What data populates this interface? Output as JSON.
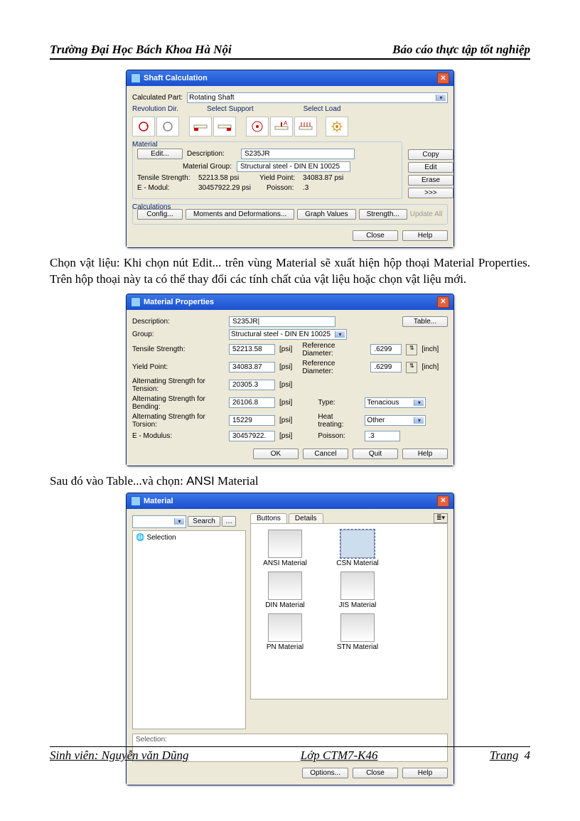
{
  "header": {
    "left": "Trường Đại Học Bách Khoa Hà Nội",
    "right": "Báo cáo thực tập tốt nghiệp"
  },
  "para1": "Chọn vật liệu: Khi chọn nút Edit... trên vùng Material sẽ xuất hiện hộp thoại Material Properties. Trên hộp thoại này ta có thể thay đổi các tính chất của vật liệu hoặc chọn vật liệu mới.",
  "para2_pre": "Sau đó vào Table...và chọn: ",
  "para2_ansi": "ANSI",
  "para2_post": " Material",
  "dlg1": {
    "title": "Shaft Calculation",
    "calculated_part_label": "Calculated Part:",
    "calculated_part_value": "Rotating Shaft",
    "rev_dir": "Revolution Dir.",
    "sel_support": "Select Support",
    "sel_load": "Select Load",
    "material_grp": "Material",
    "edit_btn": "Edit...",
    "description_label": "Description:",
    "description_value": "S235JR",
    "matgroup_label": "Material Group:",
    "matgroup_value": "Structural steel - DIN EN 10025",
    "tensile_label": "Tensile Strength:",
    "tensile_value": "52213.58 psi",
    "yield_label": "Yield Point:",
    "yield_value": "34083.87 psi",
    "emodul_label": "E - Modul:",
    "emodul_value": "30457922.29 psi",
    "poisson_label": "Poisson:",
    "poisson_value": ".3",
    "calc_grp": "Calculations",
    "config_btn": "Config...",
    "moments_btn": "Moments and Deformations...",
    "graph_btn": "Graph Values",
    "strength_btn": "Strength...",
    "update_btn": "Update All",
    "copy_btn": "Copy",
    "edit_side": "Edit",
    "erase_btn": "Erase",
    "more_btn": ">>>",
    "close_btn": "Close",
    "help_btn": "Help"
  },
  "dlg2": {
    "title": "Material Properties",
    "desc_label": "Description:",
    "desc_value": "S235JR|",
    "table_btn": "Table...",
    "group_label": "Group:",
    "group_value": "Structural steel - DIN EN 10025",
    "tensile_label": "Tensile Strength:",
    "tensile_value": "52213.58",
    "unit_psi": "[psi]",
    "refd_label": "Reference Diameter:",
    "refd_value": ".6299",
    "unit_inch": "[inch]",
    "yield_label": "Yield Point:",
    "yield_value": "34083.87",
    "refd2_label": "Reference Diameter:",
    "refd2_value": ".6299",
    "alt_tension_label": "Alternating Strength for Tension:",
    "alt_tension_value": "20305.3",
    "alt_bend_label": "Alternating Strength for Bending:",
    "alt_bend_value": "26106.8",
    "type_label": "Type:",
    "type_value": "Tenacious",
    "alt_tors_label": "Alternating Strength for Torsion:",
    "alt_tors_value": "15229",
    "heat_label": "Heat treating:",
    "heat_value": "Other",
    "emod_label": "E - Modulus:",
    "emod_value": "30457922.",
    "poisson_label": "Poisson:",
    "poisson_value": ".3",
    "ok_btn": "OK",
    "cancel_btn": "Cancel",
    "quit_btn": "Quit",
    "help_btn": "Help"
  },
  "dlg3": {
    "title": "Material",
    "search_btn": "Search",
    "selection_label": "Selection",
    "tab_buttons": "Buttons",
    "tab_details": "Details",
    "mats": [
      "ANSI Material",
      "CSN Material",
      "DIN Material",
      "JIS Material",
      "PN Material",
      "STN Material"
    ],
    "sel_panel": "Selection:",
    "options_btn": "Options...",
    "close_btn": "Close",
    "help_btn": "Help"
  },
  "footer": {
    "left": "Sinh viên: Nguyễn văn Dũng",
    "center": "Lớp CTM7-K46",
    "right_label": "Trang",
    "right_num": "4"
  }
}
